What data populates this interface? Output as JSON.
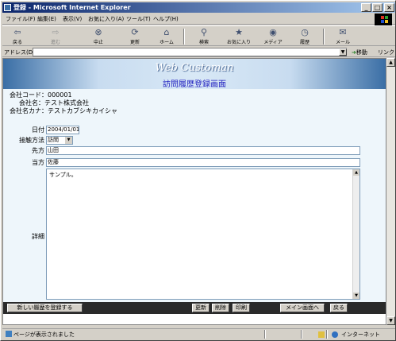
{
  "window": {
    "title": "登録 - Microsoft Internet Explorer"
  },
  "window_buttons": {
    "minimize": "_",
    "maximize": "□",
    "close": "×"
  },
  "menu": [
    "ファイル(F)",
    "編集(E)",
    "表示(V)",
    "お気に入り(A)",
    "ツール(T)",
    "ヘルプ(H)"
  ],
  "toolbar": {
    "back": "戻る",
    "forward": "進む",
    "stop": "中止",
    "refresh": "更新",
    "home": "ホーム",
    "search": "検索",
    "favorites": "お気に入り",
    "media": "メディア",
    "history": "履歴",
    "mail": "メール"
  },
  "address": {
    "label": "アドレス(D)",
    "value": "",
    "go": "移動",
    "links": "リンク »"
  },
  "banner": {
    "brand": "Web Customan",
    "page_title": "訪問履歴登録画面"
  },
  "company": {
    "code_line": "会社コード：000001",
    "name_line": "会社名：テスト株式会社",
    "kana_line": "会社名カナ：テストカブシキカイシャ"
  },
  "form": {
    "date_label": "日付",
    "date_value": "2004/01/01",
    "method_label": "接触方法",
    "method_value": "訪問",
    "client_label": "先方",
    "client_value": "山田",
    "staff_label": "当方",
    "staff_value": "佐藤",
    "detail_label": "詳細",
    "detail_value": "サンプル。"
  },
  "buttons": {
    "register_new": "新しい履歴を登録する",
    "update": "更新",
    "delete": "削除",
    "print": "印刷",
    "main_menu": "メイン画面へ",
    "back": "戻る"
  },
  "status": {
    "text": "ページが表示されました",
    "zone": "インターネット"
  }
}
